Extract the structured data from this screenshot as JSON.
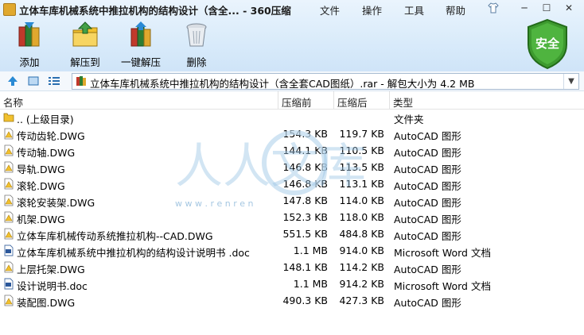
{
  "window": {
    "title": "立体车库机械系统中推拉机构的结构设计（含全... - 360压缩",
    "menu": [
      "文件",
      "操作",
      "工具",
      "帮助"
    ],
    "controls": {
      "minimize": "─",
      "maximize": "☐",
      "close": "✕"
    }
  },
  "toolbar": {
    "buttons": [
      {
        "label": "添加",
        "icon": "add-books-icon"
      },
      {
        "label": "解压到",
        "icon": "extract-folder-icon"
      },
      {
        "label": "一键解压",
        "icon": "one-click-extract-icon"
      },
      {
        "label": "删除",
        "icon": "trash-icon"
      }
    ],
    "security_badge": "安全"
  },
  "address": {
    "path": "立体车库机械系统中推拉机构的结构设计（含全套CAD图纸）.rar - 解包大小为 4.2 MB"
  },
  "columns": {
    "name": "名称",
    "compressed": "压缩前",
    "original": "压缩后",
    "type": "类型"
  },
  "files": [
    {
      "name": ".. (上级目录)",
      "csize": "",
      "osize": "",
      "type": "文件夹",
      "kind": "folder"
    },
    {
      "name": "传动齿轮.DWG",
      "csize": "154.3 KB",
      "osize": "119.7 KB",
      "type": "AutoCAD 图形",
      "kind": "dwg"
    },
    {
      "name": "传动轴.DWG",
      "csize": "144.1 KB",
      "osize": "110.5 KB",
      "type": "AutoCAD 图形",
      "kind": "dwg"
    },
    {
      "name": "导轨.DWG",
      "csize": "146.8 KB",
      "osize": "113.5 KB",
      "type": "AutoCAD 图形",
      "kind": "dwg"
    },
    {
      "name": "滚轮.DWG",
      "csize": "146.8 KB",
      "osize": "113.1 KB",
      "type": "AutoCAD 图形",
      "kind": "dwg"
    },
    {
      "name": "滚轮安装架.DWG",
      "csize": "147.8 KB",
      "osize": "114.0 KB",
      "type": "AutoCAD 图形",
      "kind": "dwg"
    },
    {
      "name": "机架.DWG",
      "csize": "152.3 KB",
      "osize": "118.0 KB",
      "type": "AutoCAD 图形",
      "kind": "dwg"
    },
    {
      "name": "立体车库机械传动系统推拉机构--CAD.DWG",
      "csize": "551.5 KB",
      "osize": "484.8 KB",
      "type": "AutoCAD 图形",
      "kind": "dwg"
    },
    {
      "name": "立体车库机械系统中推拉机构的结构设计说明书 .doc",
      "csize": "1.1 MB",
      "osize": "914.0 KB",
      "type": "Microsoft Word 文档",
      "kind": "doc"
    },
    {
      "name": "上层托架.DWG",
      "csize": "148.1 KB",
      "osize": "114.2 KB",
      "type": "AutoCAD 图形",
      "kind": "dwg"
    },
    {
      "name": "设计说明书.doc",
      "csize": "1.1 MB",
      "osize": "914.2 KB",
      "type": "Microsoft Word 文档",
      "kind": "doc"
    },
    {
      "name": "装配图.DWG",
      "csize": "490.3 KB",
      "osize": "427.3 KB",
      "type": "AutoCAD 图形",
      "kind": "dwg"
    }
  ],
  "watermark": {
    "text": "人人文库",
    "url": "w w w . r e n r e n"
  },
  "colors": {
    "accent": "#2a8ad4",
    "shield_green": "#3d9a2f",
    "dwg_yellow": "#f2c12e"
  }
}
